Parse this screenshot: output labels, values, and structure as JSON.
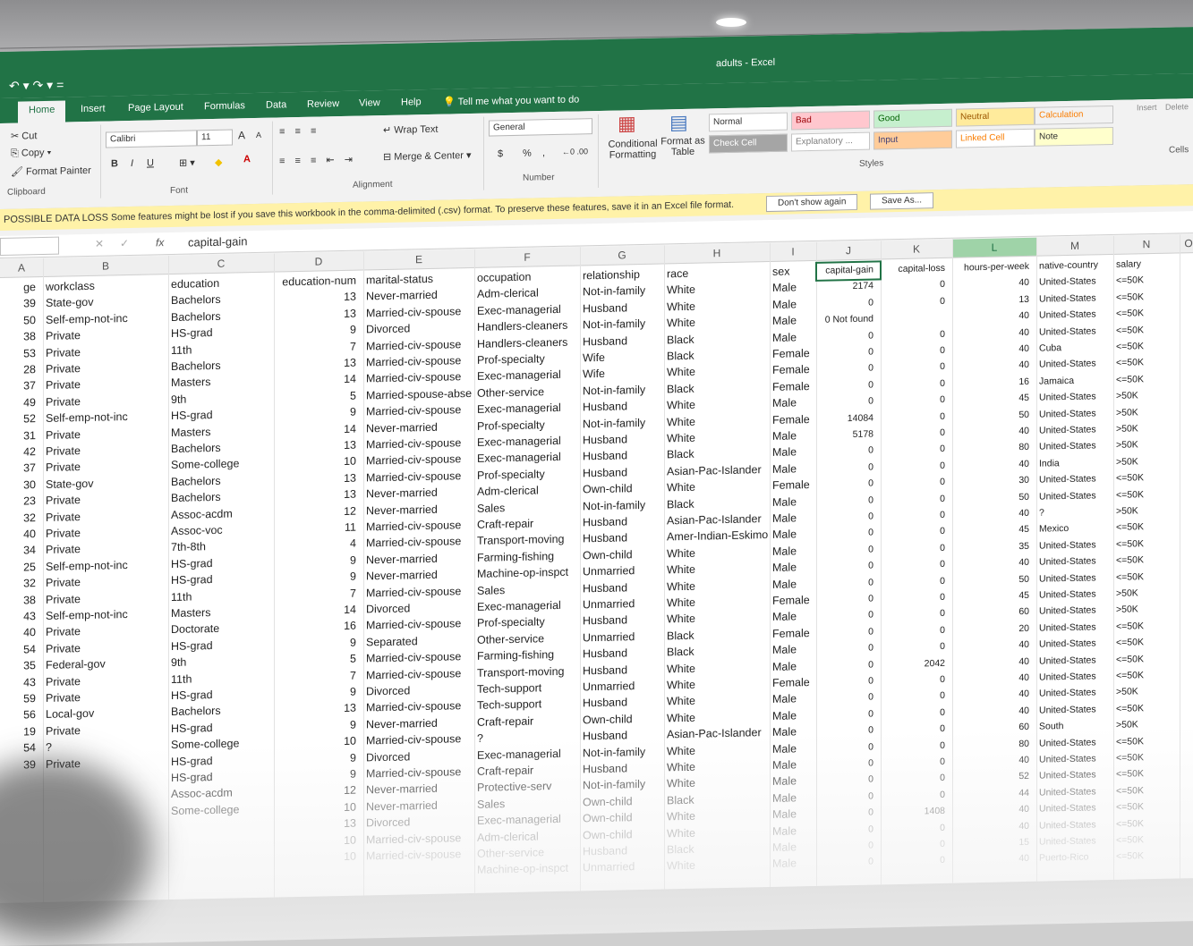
{
  "window": {
    "title": "adults - Excel",
    "qat": "↶ ▾ ↷ ▾ ="
  },
  "tabs": [
    "Home",
    "Insert",
    "Page Layout",
    "Formulas",
    "Data",
    "Review",
    "View",
    "Help"
  ],
  "tell_me": "Tell me what you want to do",
  "ribbon": {
    "clipboard": {
      "cut": "Cut",
      "copy": "Copy",
      "format_painter": "Format Painter",
      "group": "Clipboard"
    },
    "font": {
      "name": "Calibri",
      "size": "11",
      "grow": "A",
      "shrink": "A",
      "bold": "B",
      "italic": "I",
      "underline": "U",
      "group": "Font"
    },
    "alignment": {
      "wrap": "Wrap Text",
      "merge": "Merge & Center",
      "group": "Alignment"
    },
    "number": {
      "format": "General",
      "currency": "$",
      "percent": "%",
      "comma": ",",
      "group": "Number"
    },
    "styles": {
      "conditional": "Conditional Formatting",
      "format_table": "Format as Table",
      "group": "Styles",
      "cells": [
        {
          "label": "Normal",
          "bg": "#ffffff",
          "fg": "#333333"
        },
        {
          "label": "Bad",
          "bg": "#ffc7ce",
          "fg": "#9c0006"
        },
        {
          "label": "Good",
          "bg": "#c6efce",
          "fg": "#006100"
        },
        {
          "label": "Neutral",
          "bg": "#ffeb9c",
          "fg": "#9c5700"
        },
        {
          "label": "Calculation",
          "bg": "#f2f2f2",
          "fg": "#fa7d00"
        },
        {
          "label": "Check Cell",
          "bg": "#a5a5a5",
          "fg": "#ffffff"
        },
        {
          "label": "Explanatory ...",
          "bg": "#ffffff",
          "fg": "#7f7f7f"
        },
        {
          "label": "Input",
          "bg": "#ffcc99",
          "fg": "#3f3f76"
        },
        {
          "label": "Linked Cell",
          "bg": "#ffffff",
          "fg": "#fa7d00"
        },
        {
          "label": "Note",
          "bg": "#ffffcc",
          "fg": "#333333"
        }
      ]
    },
    "cells_group": {
      "insert": "Insert",
      "delete": "Delete",
      "group": "Cells"
    }
  },
  "message_bar": {
    "title": "POSSIBLE DATA LOSS",
    "text": "Some features might be lost if you save this workbook in the comma-delimited (.csv) format. To preserve these features, save it in an Excel file format.",
    "dont_show": "Don't show again",
    "save_as": "Save As..."
  },
  "formula_bar": {
    "fx": "fx",
    "value": "capital-gain"
  },
  "columns": [
    "A",
    "B",
    "C",
    "D",
    "E",
    "F",
    "G",
    "H",
    "I",
    "J",
    "K",
    "L",
    "M",
    "N",
    "O"
  ],
  "headers": [
    "ge",
    "workclass",
    "education",
    "education-num",
    "marital-status",
    "occupation",
    "relationship",
    "race",
    "sex",
    "capital-gain",
    "capital-loss",
    "hours-per-week",
    "native-country",
    "salary"
  ],
  "rows": [
    [
      "39",
      "State-gov",
      "Bachelors",
      "13",
      "Never-married",
      "Adm-clerical",
      "Not-in-family",
      "White",
      "Male",
      "2174",
      "0",
      "40",
      "United-States",
      "<=50K"
    ],
    [
      "50",
      "Self-emp-not-inc",
      "Bachelors",
      "13",
      "Married-civ-spouse",
      "Exec-managerial",
      "Husband",
      "White",
      "Male",
      "0",
      "0",
      "13",
      "United-States",
      "<=50K"
    ],
    [
      "38",
      "Private",
      "HS-grad",
      "9",
      "Divorced",
      "Handlers-cleaners",
      "Not-in-family",
      "White",
      "Male",
      "0 Not found",
      "",
      "40",
      "United-States",
      "<=50K"
    ],
    [
      "53",
      "Private",
      "11th",
      "7",
      "Married-civ-spouse",
      "Handlers-cleaners",
      "Husband",
      "Black",
      "Male",
      "0",
      "0",
      "40",
      "United-States",
      "<=50K"
    ],
    [
      "28",
      "Private",
      "Bachelors",
      "13",
      "Married-civ-spouse",
      "Prof-specialty",
      "Wife",
      "Black",
      "Female",
      "0",
      "0",
      "40",
      "Cuba",
      "<=50K"
    ],
    [
      "37",
      "Private",
      "Masters",
      "14",
      "Married-civ-spouse",
      "Exec-managerial",
      "Wife",
      "White",
      "Female",
      "0",
      "0",
      "40",
      "United-States",
      "<=50K"
    ],
    [
      "49",
      "Private",
      "9th",
      "5",
      "Married-spouse-abse",
      "Other-service",
      "Not-in-family",
      "Black",
      "Female",
      "0",
      "0",
      "16",
      "Jamaica",
      "<=50K"
    ],
    [
      "52",
      "Self-emp-not-inc",
      "HS-grad",
      "9",
      "Married-civ-spouse",
      "Exec-managerial",
      "Husband",
      "White",
      "Male",
      "0",
      "0",
      "45",
      "United-States",
      ">50K"
    ],
    [
      "31",
      "Private",
      "Masters",
      "14",
      "Never-married",
      "Prof-specialty",
      "Not-in-family",
      "White",
      "Female",
      "14084",
      "0",
      "50",
      "United-States",
      ">50K"
    ],
    [
      "42",
      "Private",
      "Bachelors",
      "13",
      "Married-civ-spouse",
      "Exec-managerial",
      "Husband",
      "White",
      "Male",
      "5178",
      "0",
      "40",
      "United-States",
      ">50K"
    ],
    [
      "37",
      "Private",
      "Some-college",
      "10",
      "Married-civ-spouse",
      "Exec-managerial",
      "Husband",
      "Black",
      "Male",
      "0",
      "0",
      "80",
      "United-States",
      ">50K"
    ],
    [
      "30",
      "State-gov",
      "Bachelors",
      "13",
      "Married-civ-spouse",
      "Prof-specialty",
      "Husband",
      "Asian-Pac-Islander",
      "Male",
      "0",
      "0",
      "40",
      "India",
      ">50K"
    ],
    [
      "23",
      "Private",
      "Bachelors",
      "13",
      "Never-married",
      "Adm-clerical",
      "Own-child",
      "White",
      "Female",
      "0",
      "0",
      "30",
      "United-States",
      "<=50K"
    ],
    [
      "32",
      "Private",
      "Assoc-acdm",
      "12",
      "Never-married",
      "Sales",
      "Not-in-family",
      "Black",
      "Male",
      "0",
      "0",
      "50",
      "United-States",
      "<=50K"
    ],
    [
      "40",
      "Private",
      "Assoc-voc",
      "11",
      "Married-civ-spouse",
      "Craft-repair",
      "Husband",
      "Asian-Pac-Islander",
      "Male",
      "0",
      "0",
      "40",
      "?",
      ">50K"
    ],
    [
      "34",
      "Private",
      "7th-8th",
      "4",
      "Married-civ-spouse",
      "Transport-moving",
      "Husband",
      "Amer-Indian-Eskimo",
      "Male",
      "0",
      "0",
      "45",
      "Mexico",
      "<=50K"
    ],
    [
      "25",
      "Self-emp-not-inc",
      "HS-grad",
      "9",
      "Never-married",
      "Farming-fishing",
      "Own-child",
      "White",
      "Male",
      "0",
      "0",
      "35",
      "United-States",
      "<=50K"
    ],
    [
      "32",
      "Private",
      "HS-grad",
      "9",
      "Never-married",
      "Machine-op-inspct",
      "Unmarried",
      "White",
      "Male",
      "0",
      "0",
      "40",
      "United-States",
      "<=50K"
    ],
    [
      "38",
      "Private",
      "11th",
      "7",
      "Married-civ-spouse",
      "Sales",
      "Husband",
      "White",
      "Male",
      "0",
      "0",
      "50",
      "United-States",
      "<=50K"
    ],
    [
      "43",
      "Self-emp-not-inc",
      "Masters",
      "14",
      "Divorced",
      "Exec-managerial",
      "Unmarried",
      "White",
      "Female",
      "0",
      "0",
      "45",
      "United-States",
      ">50K"
    ],
    [
      "40",
      "Private",
      "Doctorate",
      "16",
      "Married-civ-spouse",
      "Prof-specialty",
      "Husband",
      "White",
      "Male",
      "0",
      "0",
      "60",
      "United-States",
      ">50K"
    ],
    [
      "54",
      "Private",
      "HS-grad",
      "9",
      "Separated",
      "Other-service",
      "Unmarried",
      "Black",
      "Female",
      "0",
      "0",
      "20",
      "United-States",
      "<=50K"
    ],
    [
      "35",
      "Federal-gov",
      "9th",
      "5",
      "Married-civ-spouse",
      "Farming-fishing",
      "Husband",
      "Black",
      "Male",
      "0",
      "0",
      "40",
      "United-States",
      "<=50K"
    ],
    [
      "43",
      "Private",
      "11th",
      "7",
      "Married-civ-spouse",
      "Transport-moving",
      "Husband",
      "White",
      "Male",
      "0",
      "2042",
      "40",
      "United-States",
      "<=50K"
    ],
    [
      "59",
      "Private",
      "HS-grad",
      "9",
      "Divorced",
      "Tech-support",
      "Unmarried",
      "White",
      "Female",
      "0",
      "0",
      "40",
      "United-States",
      "<=50K"
    ],
    [
      "56",
      "Local-gov",
      "Bachelors",
      "13",
      "Married-civ-spouse",
      "Tech-support",
      "Husband",
      "White",
      "Male",
      "0",
      "0",
      "40",
      "United-States",
      ">50K"
    ],
    [
      "19",
      "Private",
      "HS-grad",
      "9",
      "Never-married",
      "Craft-repair",
      "Own-child",
      "White",
      "Male",
      "0",
      "0",
      "40",
      "United-States",
      "<=50K"
    ],
    [
      "54",
      "?",
      "Some-college",
      "10",
      "Married-civ-spouse",
      "?",
      "Husband",
      "Asian-Pac-Islander",
      "Male",
      "0",
      "0",
      "60",
      "South",
      ">50K"
    ],
    [
      "39",
      "Private",
      "HS-grad",
      "9",
      "Divorced",
      "Exec-managerial",
      "Not-in-family",
      "White",
      "Male",
      "0",
      "0",
      "80",
      "United-States",
      "<=50K"
    ],
    [
      "",
      "",
      "HS-grad",
      "9",
      "Married-civ-spouse",
      "Craft-repair",
      "Husband",
      "White",
      "Male",
      "0",
      "0",
      "40",
      "United-States",
      "<=50K"
    ],
    [
      "",
      "",
      "Assoc-acdm",
      "12",
      "Never-married",
      "Protective-serv",
      "Not-in-family",
      "White",
      "Male",
      "0",
      "0",
      "52",
      "United-States",
      "<=50K"
    ],
    [
      "",
      "",
      "Some-college",
      "10",
      "Never-married",
      "Sales",
      "Own-child",
      "Black",
      "Male",
      "0",
      "0",
      "44",
      "United-States",
      "<=50K"
    ],
    [
      "",
      "",
      "",
      "13",
      "Divorced",
      "Exec-managerial",
      "Own-child",
      "White",
      "Male",
      "0",
      "1408",
      "40",
      "United-States",
      "<=50K"
    ],
    [
      "",
      "",
      "",
      "10",
      "Married-civ-spouse",
      "Adm-clerical",
      "Own-child",
      "White",
      "Male",
      "0",
      "0",
      "40",
      "United-States",
      "<=50K"
    ],
    [
      "",
      "",
      "",
      "10",
      "Married-civ-spouse",
      "Other-service",
      "Husband",
      "Black",
      "Male",
      "0",
      "0",
      "15",
      "United-States",
      "<=50K"
    ],
    [
      "",
      "",
      "",
      "",
      "",
      "Machine-op-inspct",
      "Unmarried",
      "White",
      "Male",
      "0",
      "0",
      "40",
      "Puerto-Rico",
      "<=50K"
    ]
  ]
}
